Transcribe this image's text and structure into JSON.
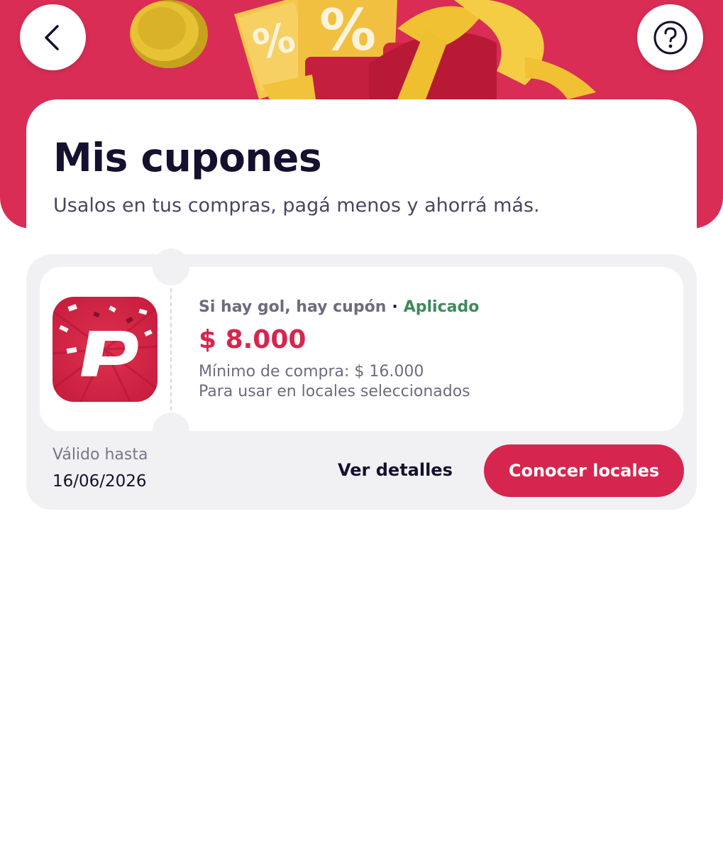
{
  "header": {
    "back_icon": "chevron-left-icon",
    "help_icon": "question-mark-circle-icon",
    "banner_art": "gift-coupon-illustration"
  },
  "page": {
    "title": "Mis cupones",
    "subtitle": "Usalos en tus compras, pagá menos y ahorrá más."
  },
  "coupon": {
    "logo_icon": "pedidosya-p-logo",
    "name": "Si hay gol, hay cupón",
    "separator": "·",
    "status": "Aplicado",
    "amount": "$ 8.000",
    "min_purchase": "Mínimo de compra: $ 16.000",
    "usage_note": "Para usar en locales seleccionados",
    "valid_label": "Válido hasta",
    "valid_date": "16/06/2026",
    "details_label": "Ver detalles",
    "cta_label": "Conocer locales"
  },
  "colors": {
    "brand": "#d92d55",
    "accent_text": "#d6264f",
    "status_green": "#3f8a5a",
    "card_bg": "#f1f1f4",
    "title_text": "#15102e"
  }
}
